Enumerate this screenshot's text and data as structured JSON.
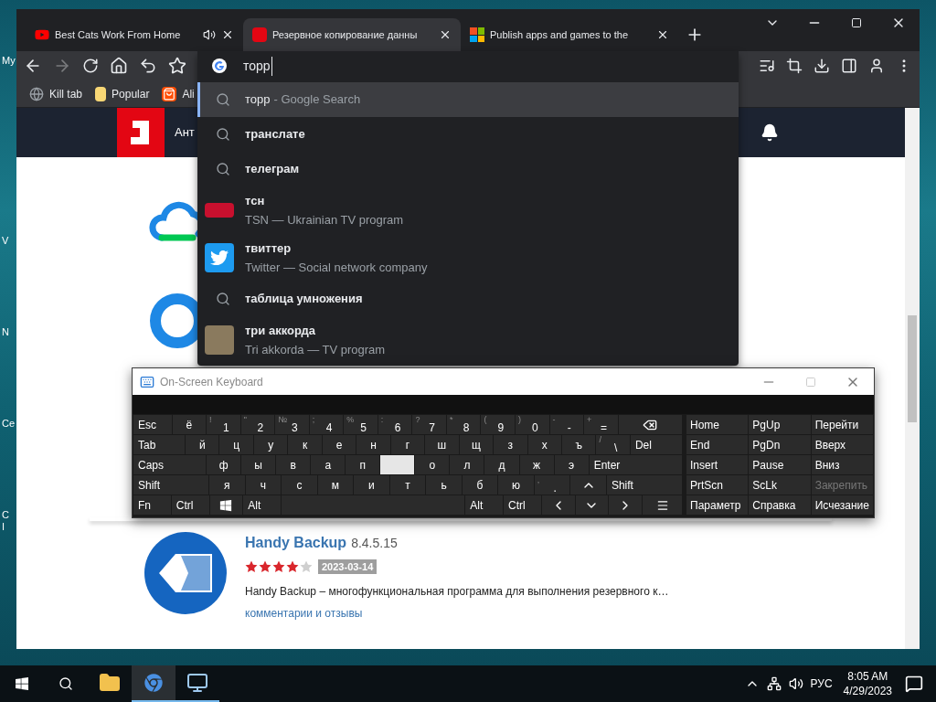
{
  "desktop": {
    "icons": [
      {
        "label": "My"
      },
      {
        "label": "V"
      },
      {
        "label": "N"
      },
      {
        "label": "Ce"
      },
      {
        "label": "C"
      },
      {
        "label": "I"
      }
    ]
  },
  "browser": {
    "tabs": [
      {
        "title": "Best Cats Work From Home",
        "audio": true,
        "selected": false
      },
      {
        "title": "Резервное копирование данны",
        "audio": false,
        "selected": true
      },
      {
        "title": "Publish apps and games to the",
        "audio": false,
        "selected": false
      }
    ],
    "bookmarks": [
      {
        "label": "Kill tab"
      },
      {
        "label": "Popular"
      },
      {
        "label": "Ali"
      }
    ],
    "omnibox": {
      "value": "торр",
      "suggestions": [
        {
          "kind": "search",
          "text": "торр",
          "detail": "- Google Search",
          "bold": false,
          "selected": true
        },
        {
          "kind": "search",
          "text": "транслате",
          "bold": true,
          "selected": false
        },
        {
          "kind": "search",
          "text": "телеграм",
          "bold": true,
          "selected": false
        },
        {
          "kind": "entity",
          "text": "тсн",
          "detail": "TSN — Ukrainian TV program",
          "bold": true,
          "selected": false
        },
        {
          "kind": "entity",
          "text": "твиттер",
          "detail": "Twitter — Social network company",
          "bold": true,
          "selected": false
        },
        {
          "kind": "search",
          "text": "таблица умножения",
          "bold": true,
          "selected": false
        },
        {
          "kind": "entity",
          "text": "три аккорда",
          "detail": "Tri akkorda — TV program",
          "bold": true,
          "selected": false
        }
      ]
    },
    "page": {
      "header": {
        "nav_text": "Ант"
      },
      "listing": {
        "name": "Handy Backup",
        "version": "8.4.5.15",
        "stars": 4,
        "date": "2023-03-14",
        "description": "Handy Backup – многофункциональная программа для выполнения резервного к…",
        "link": "комментарии и отзывы"
      }
    }
  },
  "osk": {
    "title": "On-Screen Keyboard",
    "main_rows": [
      [
        {
          "kind": "mod",
          "label": "Esc",
          "pressed": false
        },
        {
          "kind": "key",
          "label": "ё",
          "pressed": false
        },
        {
          "kind": "key",
          "label": "1",
          "shift": "!",
          "pressed": false
        },
        {
          "kind": "key",
          "label": "2",
          "shift": "\"",
          "pressed": false
        },
        {
          "kind": "key",
          "label": "3",
          "shift": "№",
          "pressed": false
        },
        {
          "kind": "key",
          "label": "4",
          "shift": ";",
          "pressed": false
        },
        {
          "kind": "key",
          "label": "5",
          "shift": "%",
          "pressed": false
        },
        {
          "kind": "key",
          "label": "6",
          "shift": ":",
          "pressed": false
        },
        {
          "kind": "key",
          "label": "7",
          "shift": "?",
          "pressed": false
        },
        {
          "kind": "key",
          "label": "8",
          "shift": "*",
          "pressed": false
        },
        {
          "kind": "key",
          "label": "9",
          "shift": "(",
          "pressed": false
        },
        {
          "kind": "key",
          "label": "0",
          "shift": ")",
          "pressed": false
        },
        {
          "kind": "key",
          "label": "-",
          "shift": "-",
          "pressed": false
        },
        {
          "kind": "key",
          "label": "=",
          "shift": "+",
          "pressed": false
        },
        {
          "kind": "backspace",
          "pressed": false
        }
      ],
      [
        {
          "kind": "wide",
          "label": "Tab",
          "pressed": false
        },
        {
          "kind": "key",
          "label": "й",
          "pressed": false
        },
        {
          "kind": "key",
          "label": "ц",
          "pressed": false
        },
        {
          "kind": "key",
          "label": "у",
          "pressed": false
        },
        {
          "kind": "key",
          "label": "к",
          "pressed": false
        },
        {
          "kind": "key",
          "label": "е",
          "pressed": false
        },
        {
          "kind": "key",
          "label": "н",
          "pressed": false
        },
        {
          "kind": "key",
          "label": "г",
          "pressed": false
        },
        {
          "kind": "key",
          "label": "ш",
          "pressed": false
        },
        {
          "kind": "key",
          "label": "щ",
          "pressed": false
        },
        {
          "kind": "key",
          "label": "з",
          "pressed": false
        },
        {
          "kind": "key",
          "label": "х",
          "pressed": false
        },
        {
          "kind": "key",
          "label": "ъ",
          "pressed": false
        },
        {
          "kind": "key",
          "label": "\\",
          "shift": "/",
          "pressed": false
        },
        {
          "kind": "wide",
          "label": "Del",
          "pressed": false
        }
      ],
      [
        {
          "kind": "caps",
          "label": "Caps",
          "pressed": false
        },
        {
          "kind": "key",
          "label": "ф",
          "pressed": false
        },
        {
          "kind": "key",
          "label": "ы",
          "pressed": false
        },
        {
          "kind": "key",
          "label": "в",
          "pressed": false
        },
        {
          "kind": "key",
          "label": "а",
          "pressed": false
        },
        {
          "kind": "key",
          "label": "п",
          "pressed": false
        },
        {
          "kind": "key",
          "pressed": true
        },
        {
          "kind": "key",
          "label": "о",
          "pressed": false
        },
        {
          "kind": "key",
          "label": "л",
          "pressed": false
        },
        {
          "kind": "key",
          "label": "д",
          "pressed": false
        },
        {
          "kind": "key",
          "label": "ж",
          "pressed": false
        },
        {
          "kind": "key",
          "label": "э",
          "pressed": false
        },
        {
          "kind": "enter",
          "label": "Enter",
          "pressed": false
        }
      ],
      [
        {
          "kind": "caps",
          "label": "Shift",
          "pressed": false
        },
        {
          "kind": "key",
          "label": "я",
          "pressed": false
        },
        {
          "kind": "key",
          "label": "ч",
          "pressed": false
        },
        {
          "kind": "key",
          "label": "с",
          "pressed": false
        },
        {
          "kind": "key",
          "label": "м",
          "pressed": false
        },
        {
          "kind": "key",
          "label": "и",
          "pressed": false
        },
        {
          "kind": "key",
          "label": "т",
          "pressed": false
        },
        {
          "kind": "key",
          "label": "ь",
          "pressed": false
        },
        {
          "kind": "key",
          "label": "б",
          "pressed": false
        },
        {
          "kind": "key",
          "label": "ю",
          "pressed": false
        },
        {
          "kind": "key",
          "label": ".",
          "shift": ",",
          "pressed": false
        },
        {
          "kind": "up",
          "pressed": false
        },
        {
          "kind": "caps",
          "label": "Shift",
          "pressed": false
        }
      ],
      [
        {
          "kind": "mod",
          "label": "Fn",
          "pressed": false
        },
        {
          "kind": "mod",
          "label": "Ctrl",
          "pressed": false
        },
        {
          "kind": "windows",
          "pressed": false
        },
        {
          "kind": "mod",
          "label": "Alt",
          "pressed": false
        },
        {
          "kind": "space",
          "pressed": false
        },
        {
          "kind": "mod",
          "label": "Alt",
          "pressed": false
        },
        {
          "kind": "mod",
          "label": "Ctrl",
          "pressed": false
        },
        {
          "kind": "left",
          "pressed": false
        },
        {
          "kind": "down",
          "pressed": false
        },
        {
          "kind": "right",
          "pressed": false
        },
        {
          "kind": "menu",
          "pressed": false
        }
      ]
    ],
    "side_rows": [
      [
        {
          "label": "Home",
          "disabled": false
        },
        {
          "label": "PgUp",
          "disabled": false
        },
        {
          "label": "Перейти",
          "disabled": false
        }
      ],
      [
        {
          "label": "End",
          "disabled": false
        },
        {
          "label": "PgDn",
          "disabled": false
        },
        {
          "label": "Вверх",
          "disabled": false
        }
      ],
      [
        {
          "label": "Insert",
          "disabled": false
        },
        {
          "label": "Pause",
          "disabled": false
        },
        {
          "label": "Вниз",
          "disabled": false
        }
      ],
      [
        {
          "label": "PrtScn",
          "disabled": false
        },
        {
          "label": "ScLk",
          "disabled": false
        },
        {
          "label": "Закрепить",
          "disabled": true
        }
      ],
      [
        {
          "label": "Параметр",
          "disabled": false
        },
        {
          "label": "Справка",
          "disabled": false
        },
        {
          "label": "Исчезание",
          "disabled": false
        }
      ]
    ]
  },
  "taskbar": {
    "apps": [
      {
        "active": false
      },
      {
        "active": true
      },
      {
        "active": true
      }
    ],
    "language": "РУС",
    "time": "8:05 AM",
    "date": "4/29/2023"
  }
}
